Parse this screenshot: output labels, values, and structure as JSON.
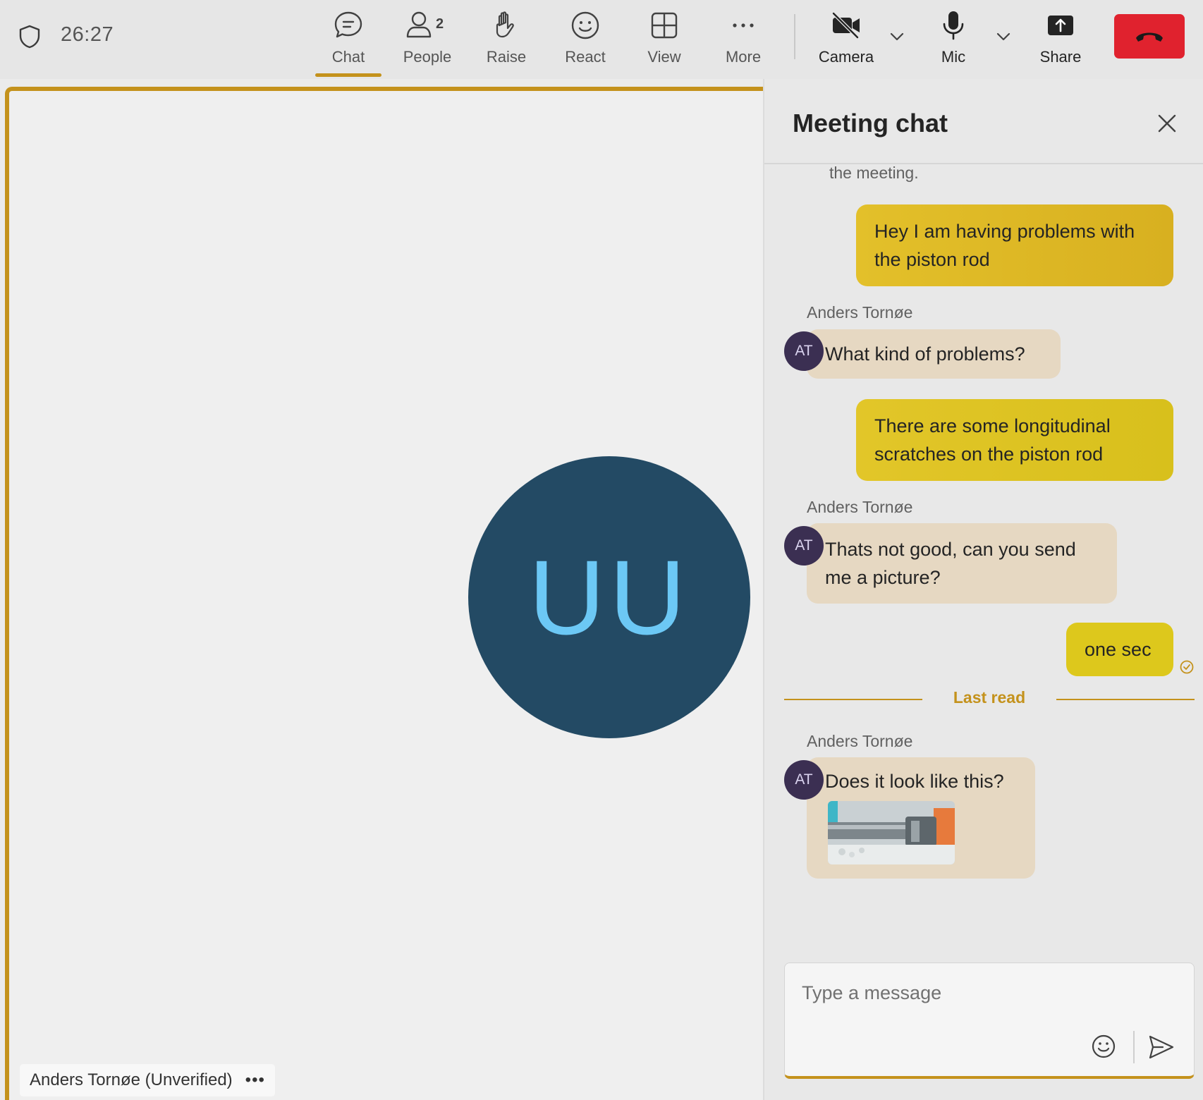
{
  "toolbar": {
    "timer": "26:27",
    "buttons": {
      "chat": {
        "label": "Chat",
        "icon": "chat-bubble-icon",
        "active": true
      },
      "people": {
        "label": "People",
        "icon": "person-icon",
        "count": "2"
      },
      "raise": {
        "label": "Raise",
        "icon": "hand-icon"
      },
      "react": {
        "label": "React",
        "icon": "smiley-icon"
      },
      "view": {
        "label": "View",
        "icon": "grid-icon"
      },
      "more": {
        "label": "More",
        "icon": "ellipsis-icon"
      },
      "camera": {
        "label": "Camera",
        "icon": "camera-off-icon"
      },
      "mic": {
        "label": "Mic",
        "icon": "microphone-icon"
      },
      "share": {
        "label": "Share",
        "icon": "share-tray-icon"
      }
    },
    "hangup_color": "#e0222e"
  },
  "stage": {
    "avatar_initials": "UU",
    "avatar_bg": "#234a64",
    "avatar_fg": "#6cc8f5",
    "participant_name": "Anders Tornøe (Unverified)",
    "accent": "#c4921c"
  },
  "chat": {
    "title": "Meeting chat",
    "system_text": "the meeting.",
    "messages": [
      {
        "from": "me",
        "text_line1": "Hey I am having problems with",
        "text_line2": "the piston rod"
      },
      {
        "from": "Anders Tornøe",
        "initials": "AT",
        "text": "What kind of problems?"
      },
      {
        "from": "me",
        "text_line1": "There are some longitudinal",
        "text_line2": "scratches on the piston rod"
      },
      {
        "from": "Anders Tornøe",
        "initials": "AT",
        "text_line1": "Thats not good, can you send",
        "text_line2": "me a picture?"
      },
      {
        "from": "me",
        "text": "one sec",
        "status_icon": "read-check-icon"
      },
      {
        "from": "Anders Tornøe",
        "initials": "AT",
        "text": "Does it look like this?",
        "attachment": "piston-rod-image"
      }
    ],
    "last_read_label": "Last read",
    "composer": {
      "placeholder": "Type a message"
    }
  }
}
